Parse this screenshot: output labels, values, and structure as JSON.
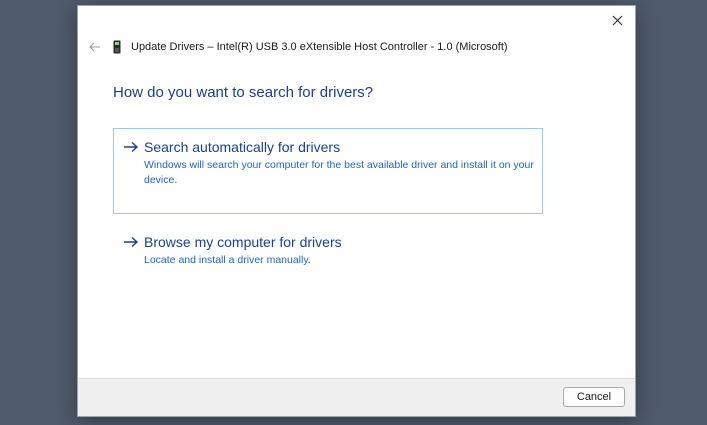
{
  "window": {
    "title": "Update Drivers – Intel(R) USB 3.0 eXtensible Host Controller - 1.0 (Microsoft)",
    "close_icon": "close-icon",
    "back_icon": "back-arrow-icon",
    "device_icon": "usb-device-icon"
  },
  "main": {
    "heading": "How do you want to search for drivers?",
    "options": [
      {
        "title": "Search automatically for drivers",
        "description": "Windows will search your computer for the best available driver and install it on your device.",
        "icon": "arrow-right-icon",
        "selected": true
      },
      {
        "title": "Browse my computer for drivers",
        "description": "Locate and install a driver manually.",
        "icon": "arrow-right-icon",
        "selected": false
      }
    ]
  },
  "footer": {
    "cancel_label": "Cancel"
  },
  "colors": {
    "desktop": "#4f5a6a",
    "heading": "#1b3f8c",
    "link_title": "#1a3f96",
    "link_desc": "#1e66c8",
    "selection_border": "#99c9ee",
    "footer_bg": "#f0f0f0"
  }
}
